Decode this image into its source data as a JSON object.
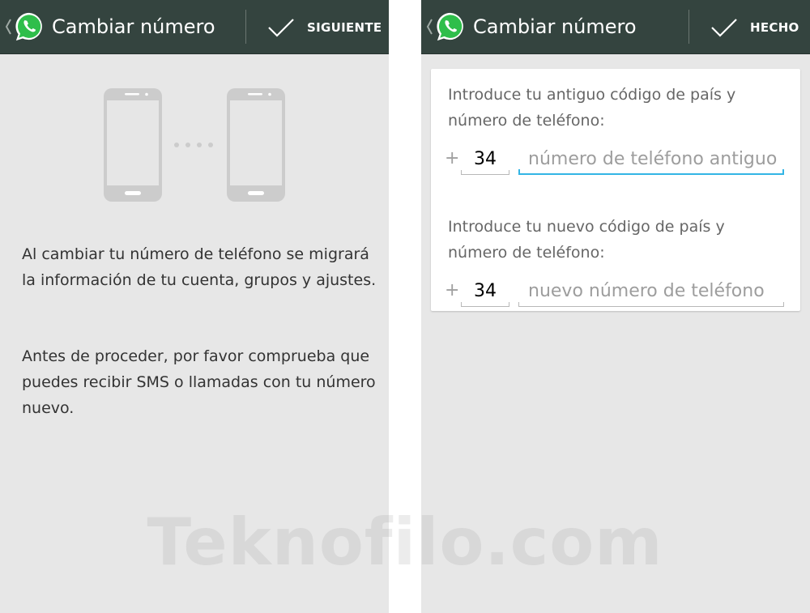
{
  "left_screen": {
    "actionbar": {
      "title": "Cambiar número",
      "action_label": "SIGUIENTE"
    },
    "paragraph_1": "Al cambiar tu número de teléfono se migrará la información de tu cuenta, grupos y ajustes.",
    "paragraph_2": "Antes de proceder, por favor comprueba que puedes recibir SMS o llamadas con tu número nuevo."
  },
  "right_screen": {
    "actionbar": {
      "title": "Cambiar número",
      "action_label": "HECHO"
    },
    "old_number": {
      "label": "Introduce tu antiguo código de país y número de teléfono:",
      "plus": "+",
      "country_code": "34",
      "placeholder": "número de teléfono antiguo"
    },
    "new_number": {
      "label": "Introduce tu nuevo código de país y número de teléfono:",
      "plus": "+",
      "country_code": "34",
      "placeholder": "nuevo número de teléfono"
    }
  },
  "watermark": "Teknofilo.com",
  "colors": {
    "actionbar_bg": "#34443f",
    "screen_bg": "#e7e7e7",
    "whatsapp_green": "#2fbe4b",
    "focus_underline": "#33b5e5"
  },
  "icons": [
    "back-chevron-icon",
    "whatsapp-logo-icon",
    "checkmark-icon",
    "phone-icon"
  ]
}
